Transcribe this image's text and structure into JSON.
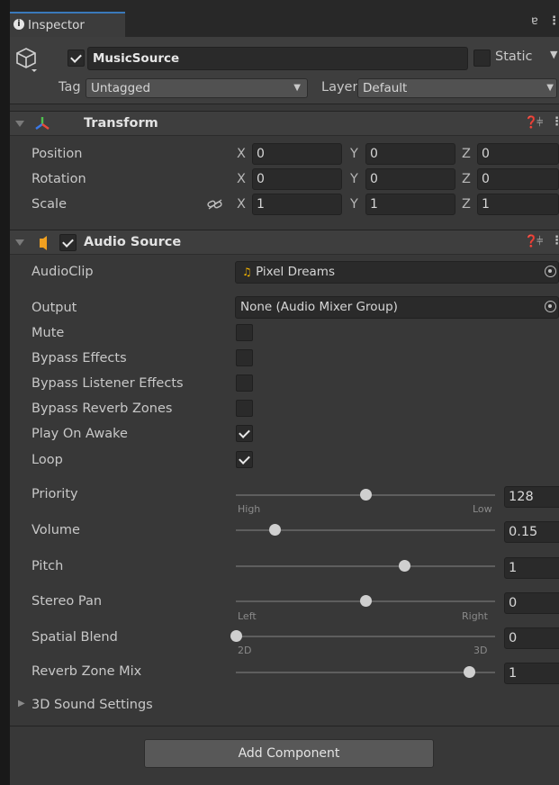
{
  "tab": {
    "title": "Inspector"
  },
  "gameobject": {
    "name": "MusicSource",
    "active": true,
    "static_label": "Static",
    "tag_label": "Tag",
    "tag_value": "Untagged",
    "layer_label": "Layer",
    "layer_value": "Default"
  },
  "transform": {
    "title": "Transform",
    "rows": [
      {
        "label": "Position",
        "x": "0",
        "y": "0",
        "z": "0"
      },
      {
        "label": "Rotation",
        "x": "0",
        "y": "0",
        "z": "0"
      },
      {
        "label": "Scale",
        "x": "1",
        "y": "1",
        "z": "1"
      }
    ],
    "axis": {
      "x": "X",
      "y": "Y",
      "z": "Z"
    }
  },
  "audio": {
    "title": "Audio Source",
    "enabled": true,
    "audioclip_label": "AudioClip",
    "audioclip_value": "Pixel Dreams",
    "output_label": "Output",
    "output_value": "None (Audio Mixer Group)",
    "mute_label": "Mute",
    "bypass_effects_label": "Bypass Effects",
    "bypass_listener_label": "Bypass Listener Effects",
    "bypass_reverb_label": "Bypass Reverb Zones",
    "play_on_awake_label": "Play On Awake",
    "loop_label": "Loop",
    "mute": false,
    "bypass_effects": false,
    "bypass_listener": false,
    "bypass_reverb": false,
    "play_on_awake": true,
    "loop": true,
    "priority": {
      "label": "Priority",
      "value": "128",
      "min_label": "High",
      "max_label": "Low",
      "fraction": 0.5
    },
    "volume": {
      "label": "Volume",
      "value": "0.15",
      "fraction": 0.15
    },
    "pitch": {
      "label": "Pitch",
      "value": "1",
      "fraction": 0.65
    },
    "stereo_pan": {
      "label": "Stereo Pan",
      "value": "0",
      "min_label": "Left",
      "max_label": "Right",
      "fraction": 0.5
    },
    "spatial_blend": {
      "label": "Spatial Blend",
      "value": "0",
      "min_label": "2D",
      "max_label": "3D",
      "fraction": 0.0
    },
    "reverb_zone_mix": {
      "label": "Reverb Zone Mix",
      "value": "1",
      "fraction": 0.9
    },
    "sound_settings_label": "3D Sound Settings"
  },
  "footer": {
    "add_component": "Add Component"
  },
  "colors": {
    "accent": "#3a79bb",
    "audio_icon": "#f0a020",
    "music_note": "#f4b400"
  }
}
